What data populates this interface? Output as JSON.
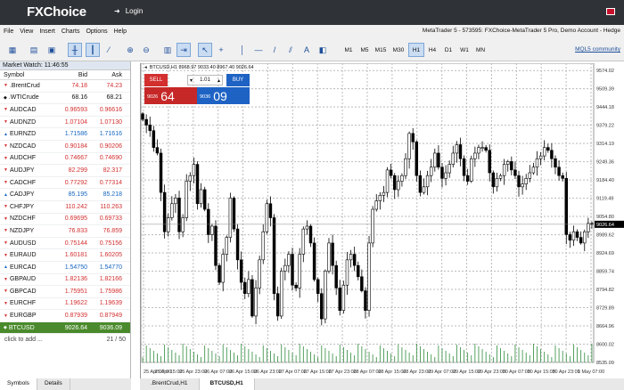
{
  "topbar": {
    "logo": "FXChoice",
    "login": "Login"
  },
  "menu": [
    "File",
    "View",
    "Insert",
    "Charts",
    "Options",
    "Help"
  ],
  "account": "MetaTrader 5 - 573595: FXChoice-MetaTrader 5 Pro, Demo Account - Hedge",
  "timeframes": [
    {
      "label": "M1",
      "active": false
    },
    {
      "label": "M5",
      "active": false
    },
    {
      "label": "M15",
      "active": false
    },
    {
      "label": "M30",
      "active": false
    },
    {
      "label": "H1",
      "active": true
    },
    {
      "label": "H4",
      "active": false
    },
    {
      "label": "D1",
      "active": false
    },
    {
      "label": "W1",
      "active": false
    },
    {
      "label": "MN",
      "active": false
    }
  ],
  "mql": "MQL5 community",
  "market_watch": {
    "title": "Market Watch: 11:46:55",
    "headers": {
      "symbol": "Symbol",
      "bid": "Bid",
      "ask": "Ask"
    },
    "rows": [
      {
        "symbol": ".BrentCrud",
        "bid": "74.18",
        "ask": "74.23",
        "dir": "dn"
      },
      {
        "symbol": ".WTICrude",
        "bid": "68.16",
        "ask": "68.21",
        "dir": "ne"
      },
      {
        "symbol": "AUDCAD",
        "bid": "0.96593",
        "ask": "0.96616",
        "dir": "dn"
      },
      {
        "symbol": "AUDNZD",
        "bid": "1.07104",
        "ask": "1.07130",
        "dir": "dn"
      },
      {
        "symbol": "EURNZD",
        "bid": "1.71586",
        "ask": "1.71616",
        "dir": "up"
      },
      {
        "symbol": "NZDCAD",
        "bid": "0.90184",
        "ask": "0.90206",
        "dir": "dn"
      },
      {
        "symbol": "AUDCHF",
        "bid": "0.74667",
        "ask": "0.74690",
        "dir": "dn"
      },
      {
        "symbol": "AUDJPY",
        "bid": "82.299",
        "ask": "82.317",
        "dir": "dn"
      },
      {
        "symbol": "CADCHF",
        "bid": "0.77292",
        "ask": "0.77314",
        "dir": "dn"
      },
      {
        "symbol": "CADJPY",
        "bid": "85.195",
        "ask": "85.218",
        "dir": "up"
      },
      {
        "symbol": "CHFJPY",
        "bid": "110.242",
        "ask": "110.263",
        "dir": "dn"
      },
      {
        "symbol": "NZDCHF",
        "bid": "0.69695",
        "ask": "0.69733",
        "dir": "dn"
      },
      {
        "symbol": "NZDJPY",
        "bid": "76.833",
        "ask": "76.859",
        "dir": "dn"
      },
      {
        "symbol": "AUDUSD",
        "bid": "0.75144",
        "ask": "0.75156",
        "dir": "dn"
      },
      {
        "symbol": "EURAUD",
        "bid": "1.60181",
        "ask": "1.60205",
        "dir": "dn"
      },
      {
        "symbol": "EURCAD",
        "bid": "1.54750",
        "ask": "1.54770",
        "dir": "up"
      },
      {
        "symbol": "GBPAUD",
        "bid": "1.82136",
        "ask": "1.82166",
        "dir": "dn"
      },
      {
        "symbol": "GBPCAD",
        "bid": "1.75951",
        "ask": "1.75986",
        "dir": "dn"
      },
      {
        "symbol": "EURCHF",
        "bid": "1.19622",
        "ask": "1.19639",
        "dir": "dn"
      },
      {
        "symbol": "EURGBP",
        "bid": "0.87939",
        "ask": "0.87949",
        "dir": "dn"
      },
      {
        "symbol": "BTCUSD",
        "bid": "9026.64",
        "ask": "9036.09",
        "dir": "sel"
      }
    ],
    "add_label": "click to add ...",
    "count": "21 / 50",
    "tabs": [
      "Symbols",
      "Details"
    ]
  },
  "chart_info": "BTCUSD,H1  8968.97 9033.40 8967.40 9026.64",
  "trade": {
    "sell": "SELL",
    "buy": "BUY",
    "volume": "1.01",
    "sell_pre": "9026",
    "sell_big": "64",
    "buy_pre": "9036",
    "buy_big": "09"
  },
  "chart_tabs": [
    {
      "label": ".BrentCrud,H1",
      "active": false
    },
    {
      "label": "BTCUSD,H1",
      "active": true
    }
  ],
  "chart_data": {
    "type": "candlestick",
    "symbol": "BTCUSD",
    "timeframe": "H1",
    "y_ticks": [
      9574.02,
      9509.39,
      9444.18,
      9379.22,
      9314.19,
      9249.36,
      9184.4,
      9119.49,
      9054.8,
      8989.62,
      8924.69,
      8859.74,
      8794.82,
      8729.89,
      8664.96,
      8600.02,
      8535.09
    ],
    "x_ticks": [
      "25 Apr 07:00",
      "25 Apr 15:00",
      "25 Apr 23:00",
      "26 Apr 07:00",
      "26 Apr 15:00",
      "26 Apr 23:00",
      "27 Apr 07:00",
      "27 Apr 15:00",
      "27 Apr 23:00",
      "28 Apr 07:00",
      "28 Apr 15:00",
      "28 Apr 23:00",
      "29 Apr 07:00",
      "29 Apr 15:00",
      "29 Apr 23:00",
      "30 Apr 07:00",
      "30 Apr 15:00",
      "30 Apr 23:00",
      "1 May 07:00"
    ],
    "current_price": "9026.64",
    "ylim": [
      8535,
      9600
    ],
    "closes": [
      9400,
      9380,
      9360,
      9300,
      9280,
      9140,
      9000,
      9050,
      9100,
      9120,
      9000,
      9050,
      9180,
      9200,
      9240,
      9100,
      9150,
      9080,
      8990,
      9020,
      8880,
      8820,
      8920,
      8980,
      9120,
      9010,
      8900,
      8820,
      8780,
      8830,
      8700,
      8800,
      8900,
      9000,
      9100,
      9050,
      8780,
      8700,
      8860,
      8880,
      8920,
      8810,
      8800,
      8920,
      9010,
      9020,
      8960,
      8830,
      8780,
      8690,
      8860,
      8960,
      8880,
      8800,
      8720,
      8810,
      8900,
      8920,
      8880,
      8840,
      8790,
      8720,
      8960,
      9080,
      9110,
      9130,
      9140,
      9220,
      9200,
      9150,
      9180,
      9200,
      9260,
      9350,
      9320,
      9200,
      9140,
      9160,
      9200,
      9230,
      9280,
      9230,
      9190,
      9210,
      9240,
      9280,
      9310,
      9260,
      9200,
      9180,
      9260,
      9280,
      9300,
      9300,
      9290,
      9210,
      9160,
      9190,
      9200,
      9240,
      9250,
      9220,
      9200,
      9160,
      9170,
      9190,
      9210,
      9230,
      9260,
      9270,
      9300,
      9290,
      9260,
      9230,
      9200,
      9190,
      8990,
      8970,
      9000,
      8980,
      8960,
      9000,
      9030,
      9026.64
    ]
  }
}
